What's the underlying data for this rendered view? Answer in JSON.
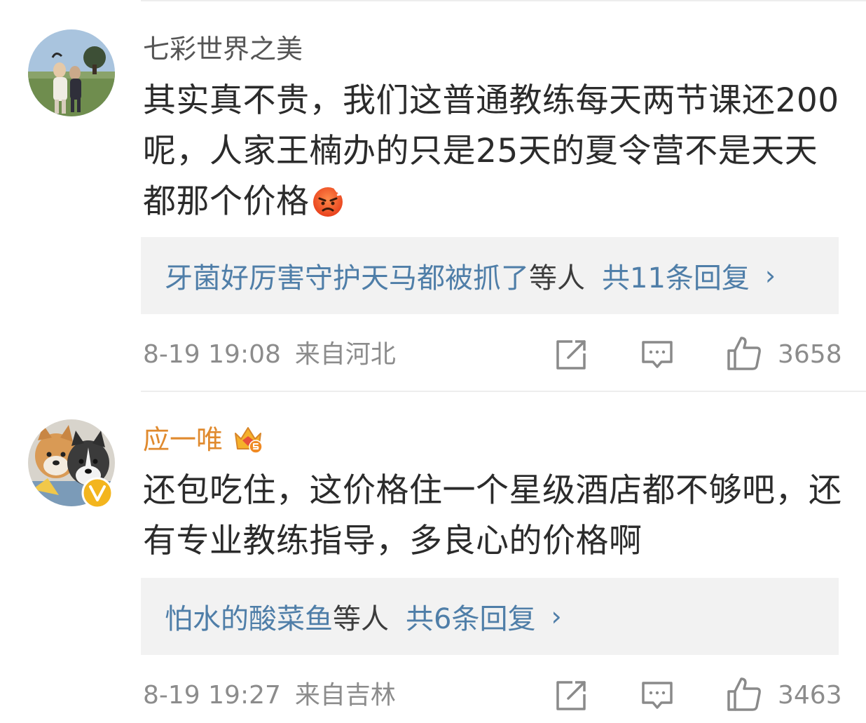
{
  "comments": [
    {
      "username": "七彩世界之美",
      "text": "其实真不贵，我们这普通教练每天两节课还200呢，人家王楠办的只是25天的夏令营不是天天都那个价格",
      "emoji": "angry-face-emoji",
      "reply_names": "牙菌好厉害守护天马都被抓了",
      "reply_suffix": "等人",
      "reply_count": "共11条回复",
      "reply_chevron": "›",
      "time": "8-19 19:08",
      "location": "来自河北",
      "likes": "3658"
    },
    {
      "username": "应一唯",
      "username_color": "#e08a2e",
      "text": "还包吃住，这价格住一个星级酒店都不够吧，还有专业教练指导，多良心的价格啊",
      "reply_names": "怕水的酸菜鱼",
      "reply_suffix": "等人",
      "reply_count": "共6条回复",
      "reply_chevron": "›",
      "time": "8-19 19:27",
      "location": "来自吉林",
      "likes": "3463"
    }
  ],
  "icons": {
    "share": "share-icon",
    "comment": "comment-icon",
    "like": "thumbs-up-icon",
    "vip": "crown-vip-icon",
    "verified": "verified-badge-icon"
  },
  "colors": {
    "username_default": "#555555",
    "reply_link": "#4f7ea8",
    "meta_gray": "#8c8c8c",
    "reply_bg": "#f2f2f2"
  }
}
